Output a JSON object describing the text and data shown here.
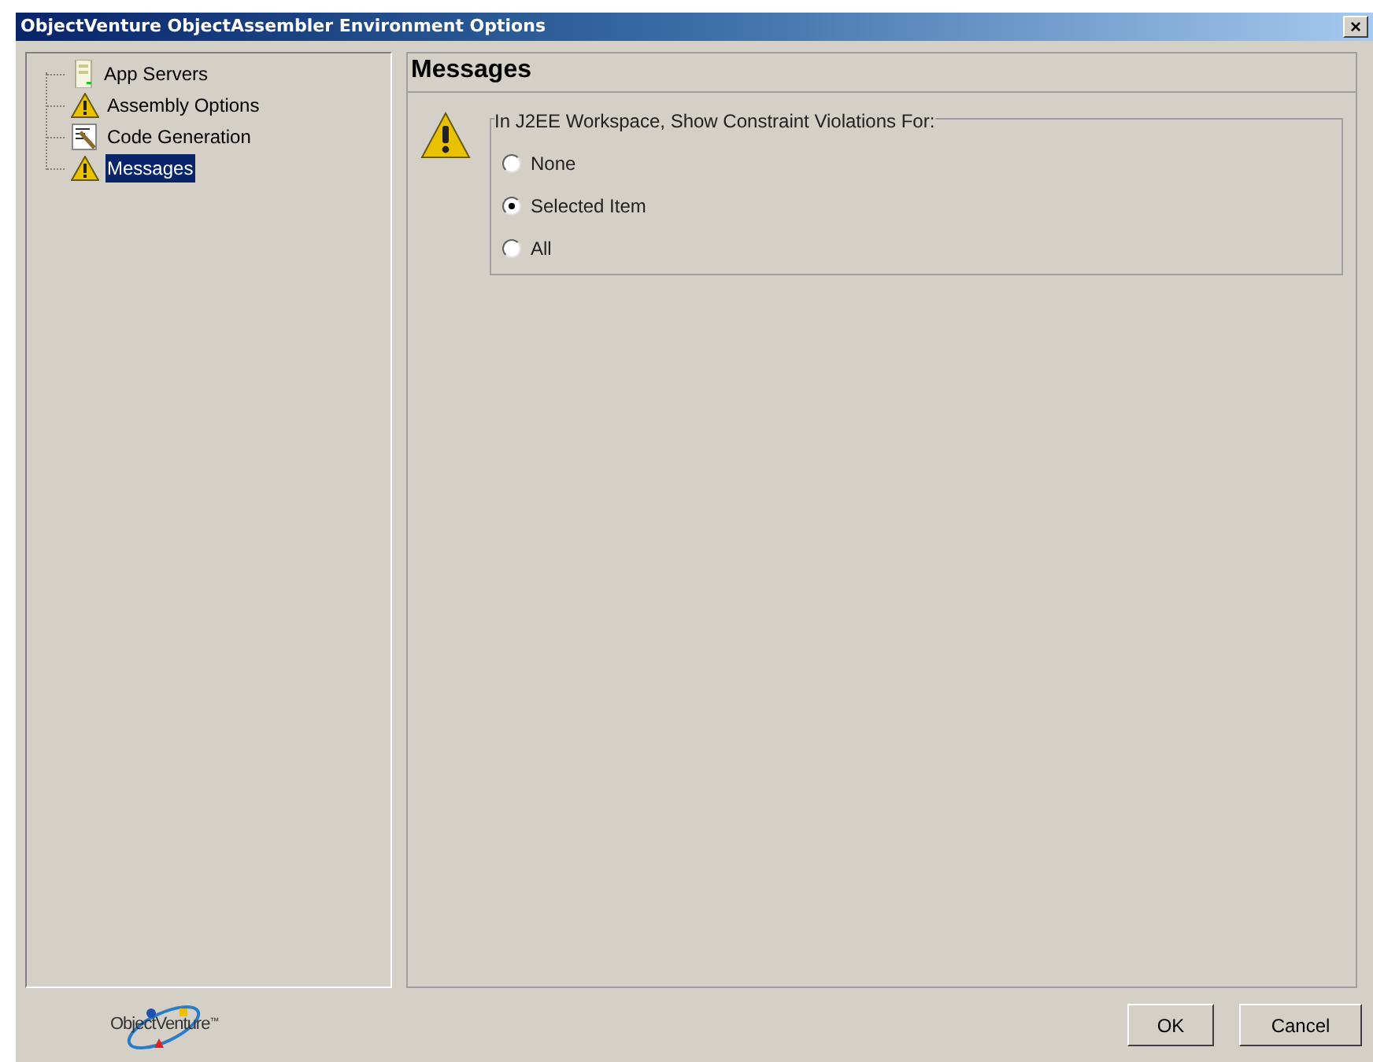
{
  "window": {
    "title": "ObjectVenture ObjectAssembler Environment Options",
    "close": "×"
  },
  "tree": {
    "items": [
      {
        "label": "App Servers",
        "kind": "server",
        "selected": false
      },
      {
        "label": "Assembly Options",
        "kind": "warning",
        "selected": false
      },
      {
        "label": "Code Generation",
        "kind": "codegen",
        "selected": false
      },
      {
        "label": "Messages",
        "kind": "warning",
        "selected": true
      }
    ]
  },
  "page": {
    "title": "Messages",
    "group": {
      "legend": "In J2EE Workspace, Show Constraint Violations For:",
      "options": [
        {
          "label": "None",
          "selected": false
        },
        {
          "label": "Selected Item",
          "selected": true
        },
        {
          "label": "All",
          "selected": false
        }
      ]
    }
  },
  "logo": {
    "text": "ObjectVenture",
    "mark": "™"
  },
  "buttons": [
    "OK",
    "Cancel"
  ]
}
